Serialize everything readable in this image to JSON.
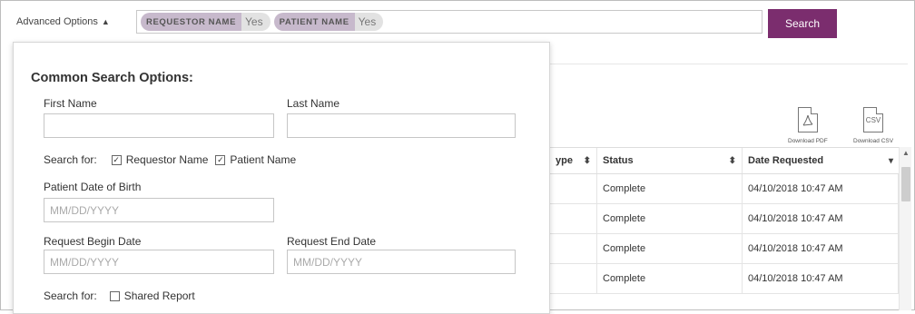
{
  "toolbar": {
    "advanced_options_label": "Advanced Options",
    "chips": [
      {
        "key": "REQUESTOR NAME",
        "value": "Yes"
      },
      {
        "key": "PATIENT NAME",
        "value": "Yes"
      }
    ],
    "search_label": "Search"
  },
  "downloads": [
    {
      "label": "Download PDF",
      "icon": "pdf-icon"
    },
    {
      "label": "Download CSV",
      "icon": "csv-icon",
      "glyph": "CSV"
    }
  ],
  "table": {
    "headers": [
      {
        "label": "ype"
      },
      {
        "label": "Status"
      },
      {
        "label": "Date Requested"
      }
    ],
    "rows": [
      {
        "status": "Complete",
        "date": "04/10/2018 10:47 AM"
      },
      {
        "status": "Complete",
        "date": "04/10/2018 10:47 AM"
      },
      {
        "status": "Complete",
        "date": "04/10/2018 10:47 AM"
      },
      {
        "status": "Complete",
        "date": "04/10/2018 10:47 AM"
      }
    ]
  },
  "panel": {
    "title": "Common Search Options:",
    "first_name_label": "First Name",
    "first_name_value": "",
    "last_name_label": "Last Name",
    "last_name_value": "",
    "search_for_label": "Search for:",
    "requestor_name_label": "Requestor Name",
    "patient_name_label": "Patient Name",
    "dob_label": "Patient Date of Birth",
    "dob_placeholder": "MM/DD/YYYY",
    "begin_date_label": "Request Begin Date",
    "begin_date_placeholder": "MM/DD/YYYY",
    "end_date_label": "Request End Date",
    "end_date_placeholder": "MM/DD/YYYY",
    "search_for_label_2": "Search for:",
    "shared_report_label": "Shared Report"
  },
  "colors": {
    "accent": "#7b2d6e",
    "chip_key_bg": "#c7b9cc"
  }
}
